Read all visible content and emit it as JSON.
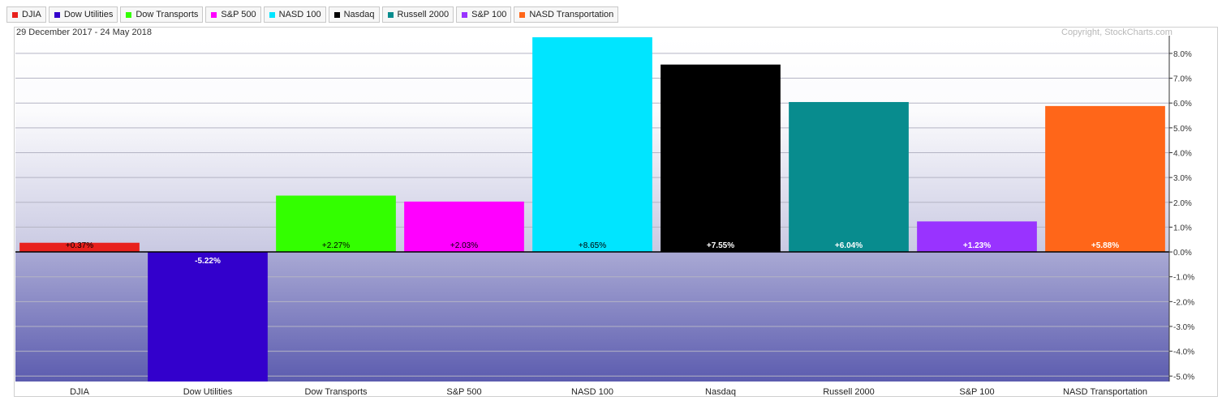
{
  "legend": [
    {
      "label": "DJIA",
      "color": "#e8211d"
    },
    {
      "label": "Dow Utilities",
      "color": "#3300cc"
    },
    {
      "label": "Dow Transports",
      "color": "#33ff00"
    },
    {
      "label": "S&P 500",
      "color": "#ff00ff"
    },
    {
      "label": "NASD 100",
      "color": "#00e5ff"
    },
    {
      "label": "Nasdaq",
      "color": "#000000"
    },
    {
      "label": "Russell 2000",
      "color": "#088c8e"
    },
    {
      "label": "S&P 100",
      "color": "#9933ff"
    },
    {
      "label": "NASD Transportation",
      "color": "#ff6619"
    }
  ],
  "header": {
    "date_range": "29 December 2017 - 24 May 2018",
    "copyright": "Copyright, StockCharts.com"
  },
  "chart_data": {
    "type": "bar",
    "categories": [
      "DJIA",
      "Dow Utilities",
      "Dow Transports",
      "S&P 500",
      "NASD 100",
      "Nasdaq",
      "Russell 2000",
      "S&P 100",
      "NASD Transportation"
    ],
    "values": [
      0.37,
      -5.22,
      2.27,
      2.03,
      8.65,
      7.55,
      6.04,
      1.23,
      5.88
    ],
    "value_labels": [
      "+0.37%",
      "-5.22%",
      "+2.27%",
      "+2.03%",
      "+8.65%",
      "+7.55%",
      "+6.04%",
      "+1.23%",
      "+5.88%"
    ],
    "colors": [
      "#e8211d",
      "#3300cc",
      "#33ff00",
      "#ff00ff",
      "#00e5ff",
      "#000000",
      "#088c8e",
      "#9933ff",
      "#ff6619"
    ],
    "label_colors": [
      "#000000",
      "#ffffff",
      "#000000",
      "#000000",
      "#000000",
      "#ffffff",
      "#ffffff",
      "#ffffff",
      "#ffffff"
    ],
    "ylim": [
      -5.22,
      8.65
    ],
    "yticks": [
      8,
      7,
      6,
      5,
      4,
      3,
      2,
      1,
      0,
      -1,
      -2,
      -3,
      -4,
      -5
    ],
    "ytick_labels": [
      "8.0%",
      "7.0%",
      "6.0%",
      "5.0%",
      "4.0%",
      "3.0%",
      "2.0%",
      "1.0%",
      "0.0%",
      "-1.0%",
      "-2.0%",
      "-3.0%",
      "-4.0%",
      "-5.0%"
    ],
    "y_axis_side": "right",
    "grid": true,
    "legend_position": "top"
  }
}
